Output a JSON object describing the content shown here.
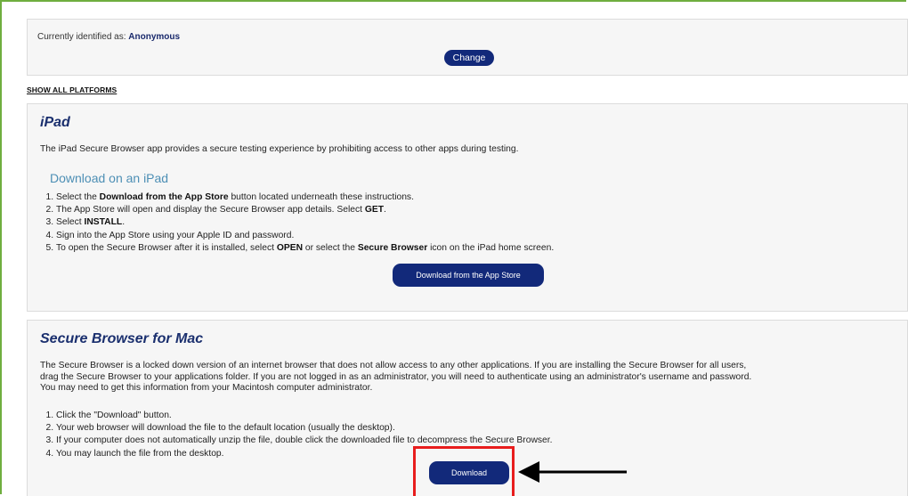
{
  "identity": {
    "label": "Currently identified as:",
    "value": "Anonymous",
    "change_label": "Change"
  },
  "show_all_platforms": "SHOW ALL PLATFORMS",
  "ipad": {
    "title": "iPad",
    "description": "The iPad Secure Browser app provides a secure testing experience by prohibiting access to other apps during testing.",
    "subheading": "Download on an iPad",
    "steps": [
      {
        "pre": "Select the ",
        "bold": "Download from the App Store",
        "post": " button located underneath these instructions."
      },
      {
        "pre": "The App Store will open and display the Secure Browser app details. Select ",
        "bold": "GET",
        "post": "."
      },
      {
        "pre": "Select ",
        "bold": "INSTALL",
        "post": "."
      },
      {
        "pre": "Sign into the App Store using your Apple ID and password.",
        "bold": "",
        "post": ""
      },
      {
        "pre": "To open the Secure Browser after it is installed, select ",
        "bold": "OPEN",
        "post": " or select the ",
        "bold2": "Secure Browser",
        "post2": " icon on the iPad home screen."
      }
    ],
    "button_label": "Download from the App Store"
  },
  "mac": {
    "title": "Secure Browser for Mac",
    "description_lines": [
      "The Secure Browser is a locked down version of an internet browser that does not allow access to any other applications. If you are installing the Secure Browser for all users,",
      "drag the Secure Browser to your applications folder. If you are not logged in as an administrator, you will need to authenticate using an administrator's username and password.",
      "You may need to get this information from your Macintosh computer administrator."
    ],
    "steps": [
      "Click the \"Download\" button.",
      "Your web browser will download the file to the default location (usually the desktop).",
      "If your computer does not automatically unzip the file, double click the downloaded file to decompress the Secure Browser.",
      "You may launch the file from the desktop."
    ],
    "button_label": "Download"
  },
  "colors": {
    "button": "#12297a",
    "highlight": "#e81d1d",
    "frame": "#6fae3f"
  }
}
